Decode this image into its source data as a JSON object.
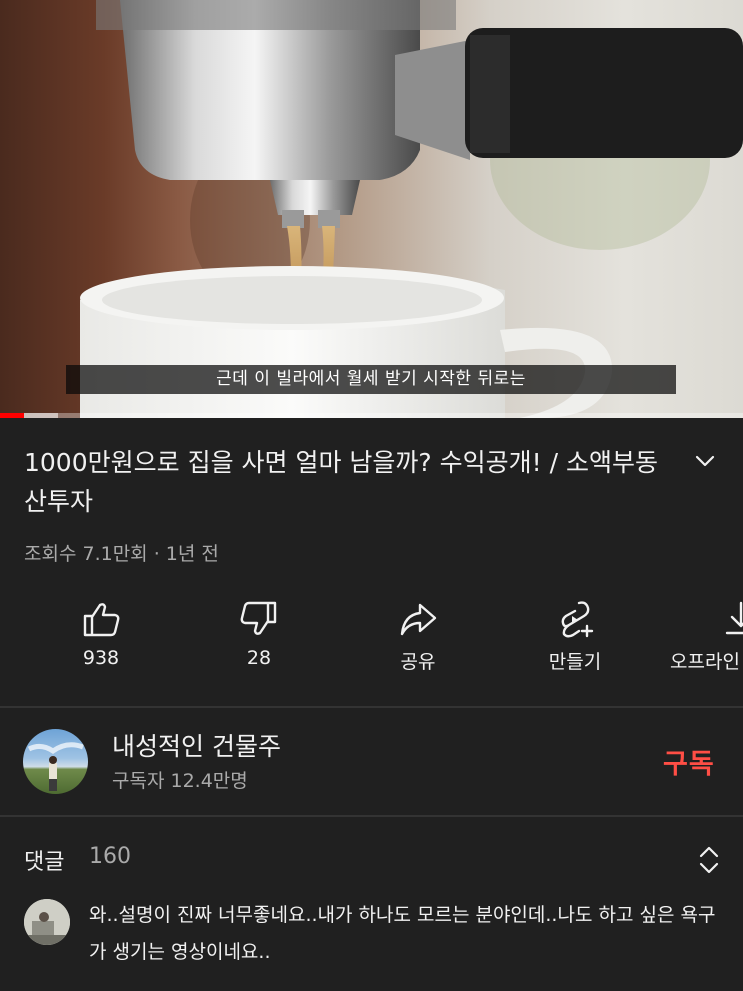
{
  "player": {
    "subtitle": "근데 이 빌라에서 월세 받기 시작한 뒤로는",
    "progress_played": 0.032,
    "progress_buffered": 0.078,
    "colors": {
      "played": "#ff0000"
    }
  },
  "video": {
    "title": "1000만원으로 집을 사면 얼마 남을까? 수익공개! / 소액부동산투자",
    "views": "조회수 7.1만회",
    "separator": "·",
    "age": "1년 전",
    "expand_icon": "chevron-down-icon"
  },
  "actions": [
    {
      "name": "like",
      "icon": "thumbs-up-icon",
      "label": "938"
    },
    {
      "name": "dislike",
      "icon": "thumbs-down-icon",
      "label": "28"
    },
    {
      "name": "share",
      "icon": "share-arrow-icon",
      "label": "공유"
    },
    {
      "name": "create",
      "icon": "shorts-create-icon",
      "label": "만들기"
    },
    {
      "name": "download",
      "icon": "download-icon",
      "label": "오프라인"
    }
  ],
  "channel": {
    "name": "내성적인 건물주",
    "subscribers": "구독자 12.4만명",
    "subscribe_label": "구독",
    "colors": {
      "subscribe": "#ff4e45"
    }
  },
  "comments": {
    "label": "댓글",
    "count": "160",
    "sort_icon": "unfold-icon",
    "top_comment": "와..설명이 진짜 너무좋네요..내가 하나도 모르는 분야인데..나도 하고 싶은 욕구가 생기는 영상이네요.."
  }
}
